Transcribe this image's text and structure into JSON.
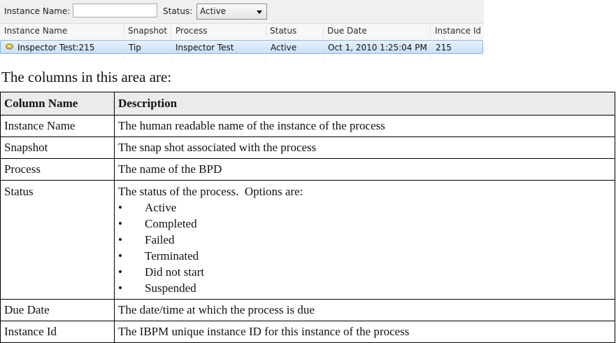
{
  "filter_bar": {
    "instance_name_label": "Instance Name:",
    "instance_name_value": "",
    "status_label": "Status:",
    "status_value": "Active"
  },
  "grid": {
    "columns": [
      "Instance Name",
      "Snapshot",
      "Process",
      "Status",
      "Due Date",
      "Instance Id"
    ],
    "rows": [
      {
        "icon": "process-instance-icon",
        "instance_name": "Inspector Test:215",
        "snapshot": "Tip",
        "process": "Inspector Test",
        "status": "Active",
        "due_date": "Oct 1, 2010 1:25:04 PM",
        "instance_id": "215"
      }
    ]
  },
  "intro_text": "The columns in this area are:",
  "doc_table": {
    "headers": [
      "Column Name",
      "Description"
    ],
    "rows": [
      {
        "name": "Instance Name",
        "description": "The human readable name of the instance of the process"
      },
      {
        "name": "Snapshot",
        "description": "The snap shot associated with the process"
      },
      {
        "name": "Process",
        "description": "The name of the BPD"
      },
      {
        "name": "Status",
        "description": "The status of the process.  Options are:",
        "options": [
          "Active",
          "Completed",
          "Failed",
          "Terminated",
          "Did not start",
          "Suspended"
        ]
      },
      {
        "name": "Due Date",
        "description": "The date/time at which the process is due"
      },
      {
        "name": "Instance Id",
        "description": "The IBPM unique instance ID for this instance of the process"
      }
    ],
    "bullet": "•"
  },
  "colors": {
    "selection_top": "#e8f2fd",
    "selection_bottom": "#c9e0fa",
    "selection_border": "#86b3e6",
    "header_bg": "#ebebeb"
  }
}
